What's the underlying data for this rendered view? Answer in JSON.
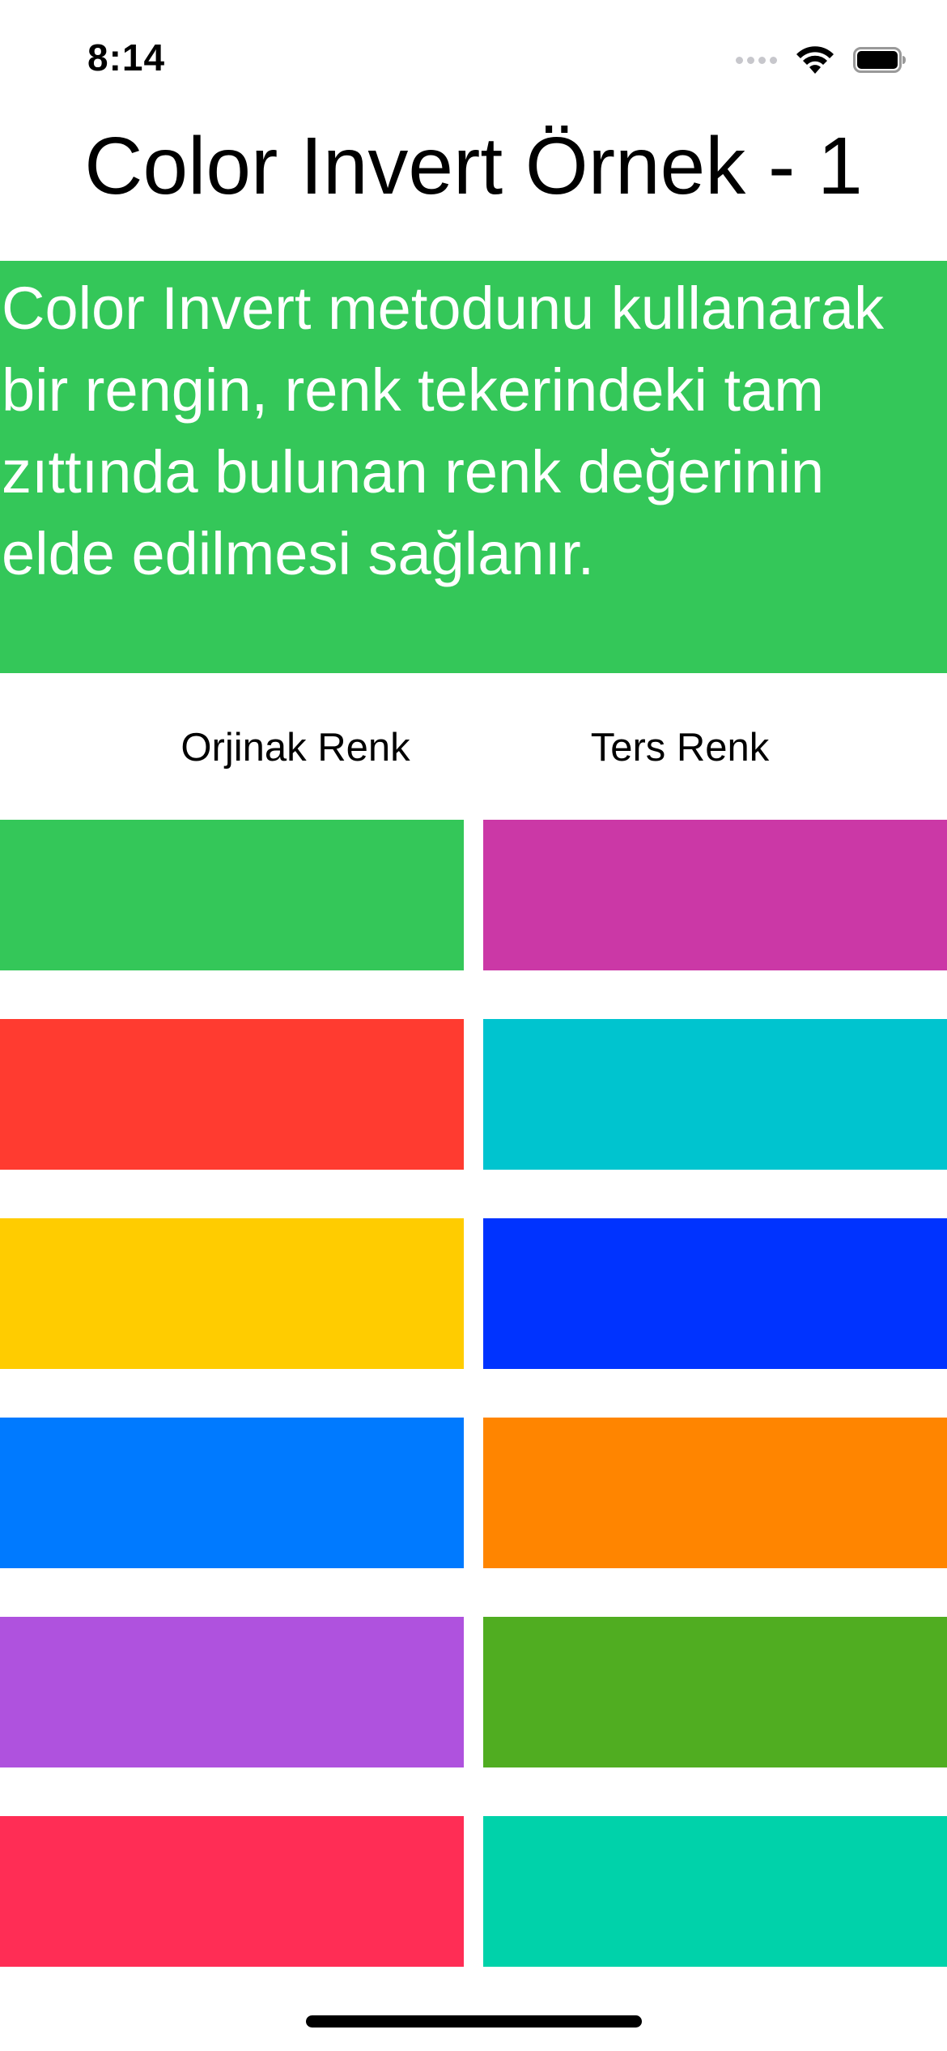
{
  "status_bar": {
    "time": "8:14",
    "icons": [
      "signal-dots-icon",
      "wifi-icon",
      "battery-icon"
    ]
  },
  "page": {
    "title": "Color Invert Örnek - 1",
    "description": "Color Invert metodunu kullanarak bir rengin, renk tekerindeki tam zıttında bulunan renk değerinin elde edilmesi sağlanır.",
    "description_bg": "#34C759",
    "description_color": "#FFFFFF"
  },
  "columns": {
    "original_label": "Orjinak Renk",
    "inverted_label": "Ters Renk"
  },
  "color_pairs": [
    {
      "original": "#34C759",
      "inverted": "#CB38A6"
    },
    {
      "original": "#FF3B30",
      "inverted": "#00C4CF"
    },
    {
      "original": "#FFCC00",
      "inverted": "#0033FF"
    },
    {
      "original": "#007AFF",
      "inverted": "#FF8500"
    },
    {
      "original": "#AF52DE",
      "inverted": "#50AD21"
    },
    {
      "original": "#FF2D55",
      "inverted": "#00D2AA"
    }
  ]
}
